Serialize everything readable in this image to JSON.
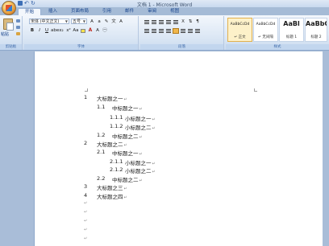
{
  "window": {
    "title": "文档 1 - Microsoft Word"
  },
  "tabs": [
    "开始",
    "插入",
    "页面布局",
    "引用",
    "邮件",
    "审阅",
    "视图"
  ],
  "clipboard": {
    "paste_label": "粘贴",
    "group_label": "剪贴板"
  },
  "font": {
    "font_name": "宋体 (中文正文)",
    "font_size": "五号",
    "group_label": "字体"
  },
  "paragraph": {
    "group_label": "段落"
  },
  "styles": {
    "group_label": "样式",
    "items": [
      {
        "sample": "AaBbCcDd",
        "name": "↵ 正文"
      },
      {
        "sample": "AaBbCcDd",
        "name": "↵ 无间隔"
      },
      {
        "sample": "AaBl",
        "name": "标题 1"
      },
      {
        "sample": "AaBbC",
        "name": "标题 2"
      }
    ]
  },
  "document": {
    "lines": [
      {
        "num": "1",
        "text": "大标题之一"
      },
      {
        "num": "1.1",
        "text": "中标题之一"
      },
      {
        "num": "1.1.1",
        "text": "小标题之一"
      },
      {
        "num": "1.1.2",
        "text": "小标题之二"
      },
      {
        "num": "1.2",
        "text": "中标题之二"
      },
      {
        "num": "2",
        "text": "大标题之二"
      },
      {
        "num": "2.1",
        "text": "中标题之一"
      },
      {
        "num": "2.1.1",
        "text": "小标题之一"
      },
      {
        "num": "2.1.2",
        "text": "小标题之二"
      },
      {
        "num": "2.2",
        "text": "中标题之二"
      },
      {
        "num": "3",
        "text": "大标题之三"
      },
      {
        "num": "4",
        "text": "大标题之四"
      }
    ],
    "paragraph_mark": "↵"
  }
}
